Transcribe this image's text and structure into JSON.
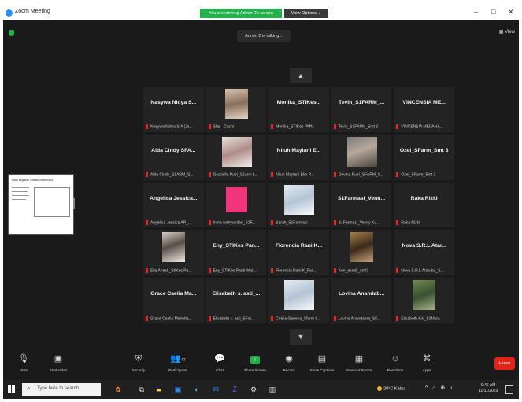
{
  "window": {
    "title": "Zoom Meeting",
    "minimize": "–",
    "maximize": "□",
    "close": "✕"
  },
  "banner": {
    "sharing_text": "You are viewing Admin 2's screen",
    "view_options": "View Options ⌄"
  },
  "speaker_indicator": "Admin 2 is talking...",
  "view_button": "View",
  "participants": [
    {
      "name": "Nasywa Nidya S...",
      "label": "Nasywa Nidya S.A (Ja..."
    },
    {
      "name": "",
      "label": "Star - Cachi"
    },
    {
      "name": "Monika_STIKes...",
      "label": "Monika_STIKes PMM"
    },
    {
      "name": "Tevin_S1FARM_...",
      "label": "Tevin_S1FARM_Smt 3"
    },
    {
      "name": "VINCENSIA ME...",
      "label": "VINCENSIA MEDAHA..."
    },
    {
      "name": "Alda Cindy SFA...",
      "label": "Alda Cindy_S1ARM_S..."
    },
    {
      "name": "",
      "label": "Graciella Putri_S1arm t..."
    },
    {
      "name": "Niluh Maylani E...",
      "label": "Niluh Maylani Eko P..."
    },
    {
      "name": "",
      "label": "Devina Putri_SFARM_S..."
    },
    {
      "name": "Ozel_SFarm_Smt 3",
      "label": "Ozel_SFarm_Smt 3"
    },
    {
      "name": "Angelica Jessica...",
      "label": "Angelica Jessica AP_..."
    },
    {
      "name": "",
      "label": "Inma wahyundari_S1F..."
    },
    {
      "name": "",
      "label": "Sarah_S1Farmasi"
    },
    {
      "name": "S1Farmasi_Venn...",
      "label": "S1Farmasi_Venny Ku..."
    },
    {
      "name": "Raka Rizki",
      "label": "Raka Rizki"
    },
    {
      "name": "",
      "label": "Elia Anesti_StIKes Pa..."
    },
    {
      "name": "Eny_STIKes Pan...",
      "label": "Eny_STIKes Panti Wal..."
    },
    {
      "name": "Florencia Rani K...",
      "label": "Florencia Rani K_Far..."
    },
    {
      "name": "",
      "label": "Ken_ekmik_smt3"
    },
    {
      "name": "Nova S.R.L Atar...",
      "label": "Nova S.R.L Atarubu_S..."
    },
    {
      "name": "Grace Caelia Ma...",
      "label": "Grace Caelia Marietta..."
    },
    {
      "name": "Elisabeth s. asti_...",
      "label": "Elisabeth s. asti_SFar..."
    },
    {
      "name": "",
      "label": "Celsia Ganesa_Sfarm t..."
    },
    {
      "name": "Lovina Anandab...",
      "label": "Lovina Anandabra_SF..."
    },
    {
      "name": "",
      "label": "Elisabeth Kin_S1Mrsa"
    }
  ],
  "shared_screen": {
    "title": "Hasil kegiatan Visitasi Sederhana"
  },
  "toolbar": {
    "mute": "Mute",
    "start_video": "Start Video",
    "security": "Security",
    "participants": "Participants",
    "participants_count": "47",
    "chat": "Chat",
    "share_screen": "Share Screen",
    "record": "Record",
    "show_captions": "Show Captions",
    "breakout_rooms": "Breakout Rooms",
    "reactions": "Reactions",
    "apps": "Apps",
    "leave": "Leave"
  },
  "taskbar": {
    "search_placeholder": "Type here to search",
    "weather": "28°C Kabut",
    "time": "9:46 AM",
    "date": "11/11/2023"
  },
  "colors": {
    "accent_green": "#22b14c",
    "leave_red": "#e0231b",
    "mic_off_red": "#e02828",
    "zoom_blue": "#2d8cff"
  }
}
